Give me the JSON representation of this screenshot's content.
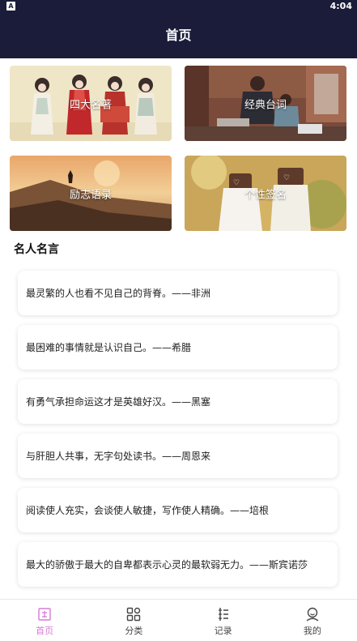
{
  "status_bar": {
    "app_badge": "A",
    "time": "4:04"
  },
  "header": {
    "title": "首页"
  },
  "categories": [
    {
      "label": "四大名著"
    },
    {
      "label": "经典台词"
    },
    {
      "label": "励志语录"
    },
    {
      "label": "个性签名"
    }
  ],
  "section": {
    "title": "名人名言"
  },
  "quotes": [
    {
      "text": "最灵繁的人也看不见自己的背脊。——非洲"
    },
    {
      "text": "最困难的事情就是认识自己。——希腊"
    },
    {
      "text": "有勇气承担命运这才是英雄好汉。——黑塞"
    },
    {
      "text": "与肝胆人共事，无字句处读书。——周恩来"
    },
    {
      "text": "阅读使人充实，会谈使人敏捷，写作使人精确。——培根"
    },
    {
      "text": "最大的骄傲于最大的自卑都表示心灵的最软弱无力。——斯宾诺莎"
    }
  ],
  "tabbar": {
    "items": [
      {
        "label": "首页",
        "icon": "home-icon",
        "active": true
      },
      {
        "label": "分类",
        "icon": "category-grid-icon",
        "active": false
      },
      {
        "label": "记录",
        "icon": "record-icon",
        "active": false
      },
      {
        "label": "我的",
        "icon": "profile-icon",
        "active": false
      }
    ]
  },
  "colors": {
    "header_bg": "#1b1c3a",
    "accent": "#d77bd6"
  }
}
